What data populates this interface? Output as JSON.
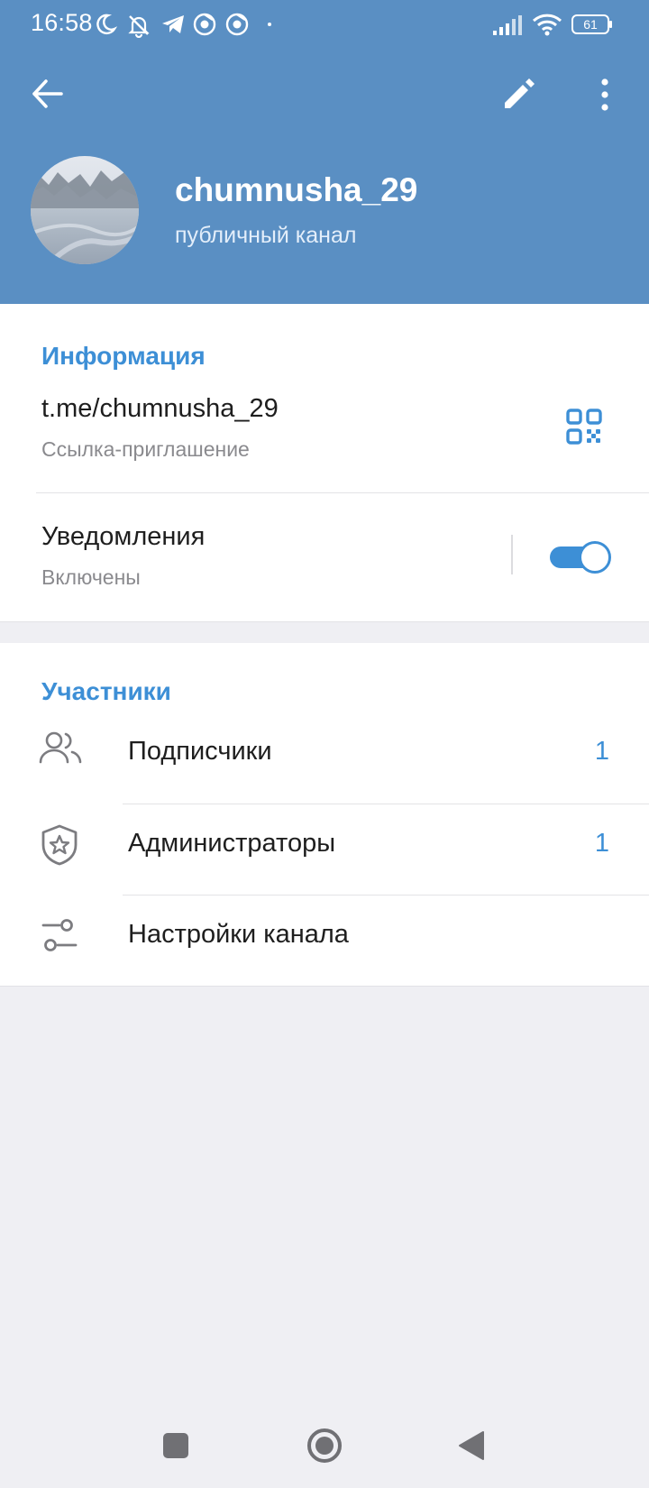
{
  "status_bar": {
    "time": "16:58",
    "battery": "61"
  },
  "header": {
    "title": "chumnusha_29",
    "subtitle": "публичный канал",
    "background": "#5a8fc3"
  },
  "info": {
    "section_title": "Информация",
    "link": "t.me/chumnusha_29",
    "link_caption": "Ссылка-приглашение",
    "notifications_label": "Уведомления",
    "notifications_state": "Включены",
    "notifications_enabled": true
  },
  "members": {
    "section_title": "Участники",
    "rows": [
      {
        "label": "Подписчики",
        "count": "1",
        "icon": "people-icon"
      },
      {
        "label": "Администраторы",
        "count": "1",
        "icon": "shield-star-icon"
      },
      {
        "label": "Настройки канала",
        "count": "",
        "icon": "sliders-icon"
      }
    ]
  },
  "colors": {
    "accent": "#3d8fd6",
    "header": "#5a8fc3",
    "background": "#efeff3"
  }
}
